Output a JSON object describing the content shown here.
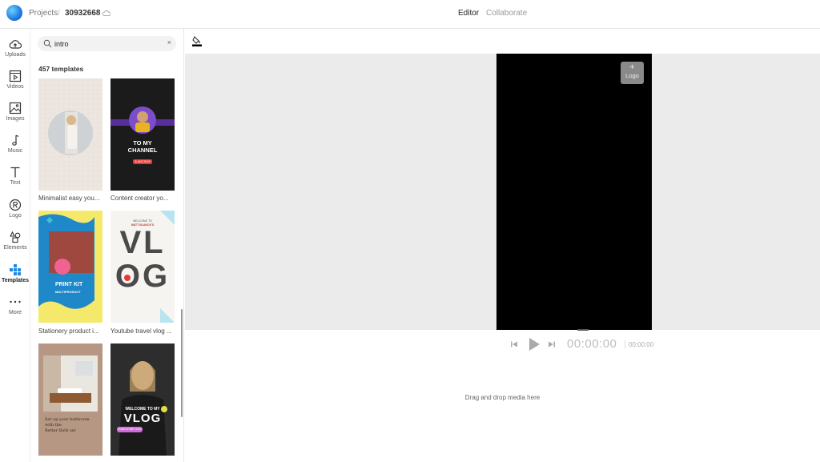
{
  "header": {
    "projects_label": "Projects",
    "separator": "/",
    "project_id": "30932668",
    "tabs": [
      {
        "label": "Editor",
        "active": true
      },
      {
        "label": "Collaborate",
        "active": false
      }
    ]
  },
  "nav": {
    "items": [
      {
        "label": "Uploads",
        "icon": "upload-cloud-icon"
      },
      {
        "label": "Videos",
        "icon": "video-file-icon"
      },
      {
        "label": "Images",
        "icon": "image-icon"
      },
      {
        "label": "Music",
        "icon": "music-note-icon"
      },
      {
        "label": "Text",
        "icon": "text-t-icon"
      },
      {
        "label": "Logo",
        "icon": "registered-icon"
      },
      {
        "label": "Elements",
        "icon": "shapes-icon"
      },
      {
        "label": "Templates",
        "icon": "templates-grid-icon",
        "active": true
      },
      {
        "label": "More",
        "icon": "more-dots-icon"
      }
    ]
  },
  "panel": {
    "search_value": "intro",
    "clear_glyph": "×",
    "count_label": "457 templates",
    "templates": [
      {
        "title": "Minimalist easy you...",
        "thumb_text": []
      },
      {
        "title": "Content creator yo...",
        "thumb_text": [
          "TO MY",
          "CHANNEL",
          "SUBSCRIBE"
        ]
      },
      {
        "title": "Stationery product i...",
        "thumb_text": [
          "PRINT KIT",
          "MULTIPRODUCT"
        ]
      },
      {
        "title": "Youtube travel vlog ...",
        "thumb_text": [
          "WELCOME TO",
          "MATT BLANCK'S",
          "VL",
          "OG"
        ]
      },
      {
        "title": "",
        "thumb_text": [
          "Set up your bathroom",
          "with the",
          "Better Bath set"
        ]
      },
      {
        "title": "",
        "thumb_text": [
          "WELCOME TO MY",
          "VLOG",
          "SUBSCRIBE NOW"
        ]
      }
    ]
  },
  "stage": {
    "logo_button_plus": "+",
    "logo_button_label": "Logo"
  },
  "player": {
    "time_current": "00:00:00",
    "time_total": "00:00:00"
  },
  "timeline": {
    "drop_message": "Drag and drop media here"
  },
  "colors": {
    "accent": "#1e88e5",
    "stage_bg": "#ebebeb",
    "video_bg": "#000000"
  }
}
